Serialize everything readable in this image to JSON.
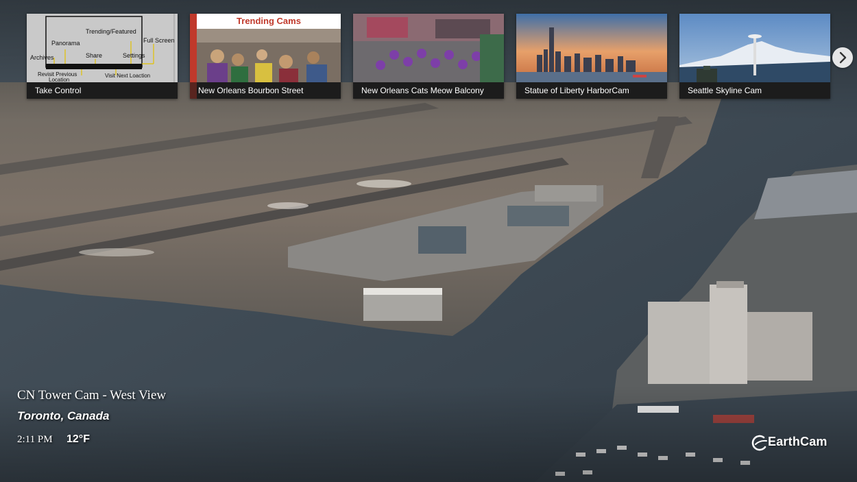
{
  "camera": {
    "title": "CN Tower Cam - West View",
    "location": "Toronto, Canada",
    "time": "2:11 PM",
    "temperature": "12°F"
  },
  "carousel": {
    "thumbnails": [
      {
        "caption": "Take Control",
        "diagram_labels": {
          "trending": "Trending/Featured",
          "full_screen": "Full Screen",
          "panorama": "Panorama",
          "share": "Share",
          "settings": "Settings",
          "archives": "Archives",
          "revisit": "Revisit Previous",
          "revisit2": "Location",
          "visit_next": "Visit Next Loaction"
        }
      },
      {
        "caption": "New Orleans Bourbon Street",
        "header": "Trending Cams"
      },
      {
        "caption": "New Orleans Cats Meow Balcony"
      },
      {
        "caption": "Statue of Liberty HarborCam"
      },
      {
        "caption": "Seattle Skyline Cam"
      }
    ],
    "next_icon": "chevron-right-icon"
  },
  "logo": {
    "text": "EarthCam"
  },
  "colors": {
    "trending_red": "#c0392b",
    "water": "#3d4a55",
    "snow_ground": "#9a8e80"
  }
}
